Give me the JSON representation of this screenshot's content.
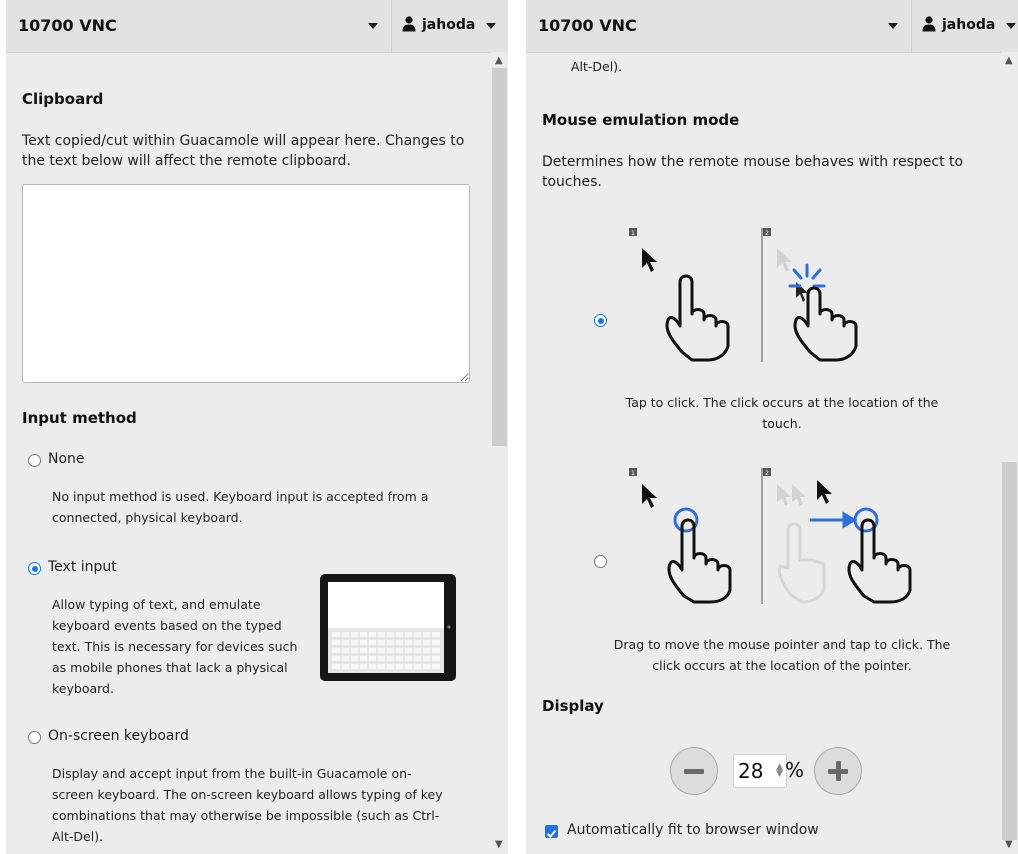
{
  "header": {
    "title": "10700 VNC",
    "user": "jahoda"
  },
  "left": {
    "clipboard": {
      "heading": "Clipboard",
      "description": "Text copied/cut within Guacamole will appear here. Changes to the text below will affect the remote clipboard.",
      "value": ""
    },
    "input_method": {
      "heading": "Input method",
      "options": [
        {
          "label": "None",
          "checked": false,
          "description": "No input method is used. Keyboard input is accepted from a connected, physical keyboard."
        },
        {
          "label": "Text input",
          "checked": true,
          "description": "Allow typing of text, and emulate keyboard events based on the typed text. This is necessary for devices such as mobile phones that lack a physical keyboard."
        },
        {
          "label": "On-screen keyboard",
          "checked": false,
          "description": "Display and accept input from the built-in Guacamole on-screen keyboard. The on-screen keyboard allows typing of key combinations that may otherwise be impossible (such as Ctrl-Alt-Del)."
        }
      ]
    }
  },
  "right": {
    "top_fragment": "Alt-Del).",
    "mouse": {
      "heading": "Mouse emulation mode",
      "description": "Determines how the remote mouse behaves with respect to touches.",
      "modes": [
        {
          "checked": true,
          "caption": "Tap to click. The click occurs at the location of the touch.",
          "step_labels": [
            "1",
            "2"
          ]
        },
        {
          "checked": false,
          "caption": "Drag to move the mouse pointer and tap to click. The click occurs at the location of the pointer.",
          "step_labels": [
            "1",
            "2"
          ]
        }
      ]
    },
    "display": {
      "heading": "Display",
      "zoom_value": "28",
      "zoom_unit": "%",
      "auto_fit_label": "Automatically fit to browser window",
      "auto_fit_checked": true
    }
  },
  "colors": {
    "accent": "#1a73e8",
    "panel_bg": "#ececec",
    "header_bg": "#e2e2e2"
  },
  "icons": {
    "user": "user-icon",
    "caret": "caret-down-icon",
    "zoom_out": "minus-icon",
    "zoom_in": "plus-icon",
    "check": "check-icon"
  }
}
